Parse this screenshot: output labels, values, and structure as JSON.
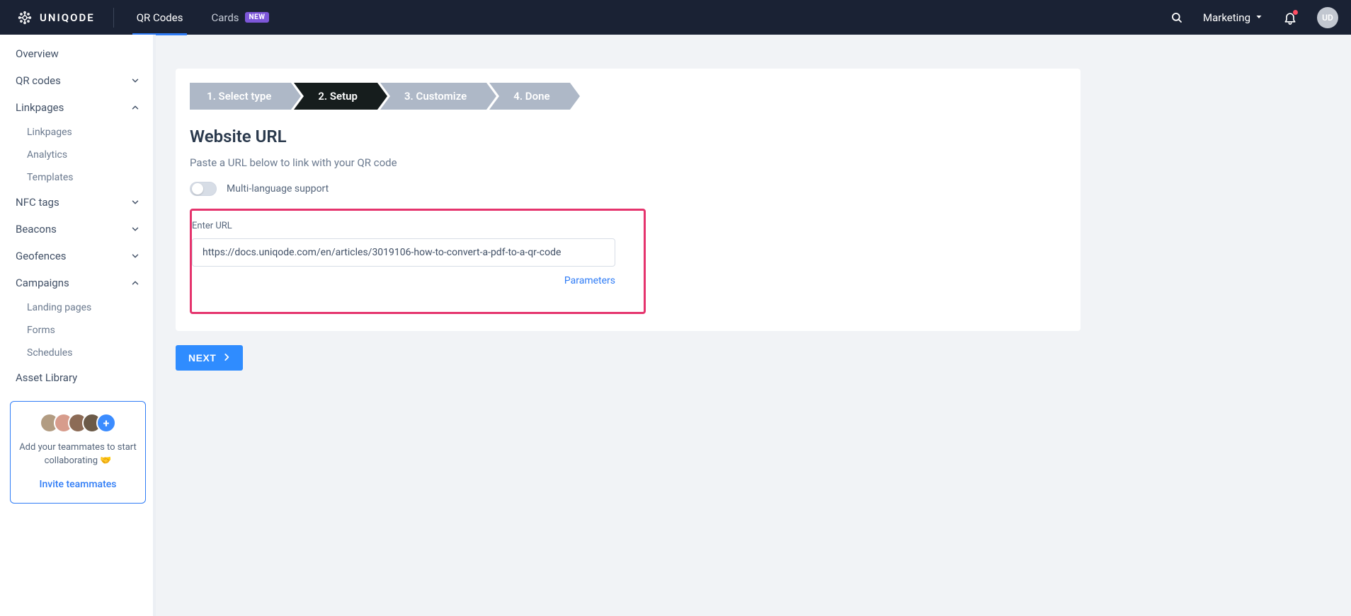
{
  "header": {
    "brand": "UNIQODE",
    "nav": {
      "qr_codes": "QR Codes",
      "cards": "Cards",
      "new_badge": "NEW"
    },
    "team_label": "Marketing",
    "avatar_initials": "UD"
  },
  "sidebar": {
    "overview": "Overview",
    "qr_codes": "QR codes",
    "linkpages": "Linkpages",
    "linkpages_children": {
      "linkpages": "Linkpages",
      "analytics": "Analytics",
      "templates": "Templates"
    },
    "nfc_tags": "NFC tags",
    "beacons": "Beacons",
    "geofences": "Geofences",
    "campaigns": "Campaigns",
    "campaigns_children": {
      "landing_pages": "Landing pages",
      "forms": "Forms",
      "schedules": "Schedules"
    },
    "asset_library": "Asset Library",
    "invite": {
      "text": "Add your teammates to start collaborating 🤝",
      "link": "Invite teammates"
    }
  },
  "stepper": {
    "step1": "1. Select type",
    "step2": "2. Setup",
    "step3": "3. Customize",
    "step4": "4. Done"
  },
  "main": {
    "title": "Website URL",
    "subtitle": "Paste a URL below to link with your QR code",
    "multi_lang_label": "Multi-language support",
    "url_label": "Enter URL",
    "url_value": "https://docs.uniqode.com/en/articles/3019106-how-to-convert-a-pdf-to-a-qr-code",
    "parameters": "Parameters",
    "next": "NEXT"
  }
}
